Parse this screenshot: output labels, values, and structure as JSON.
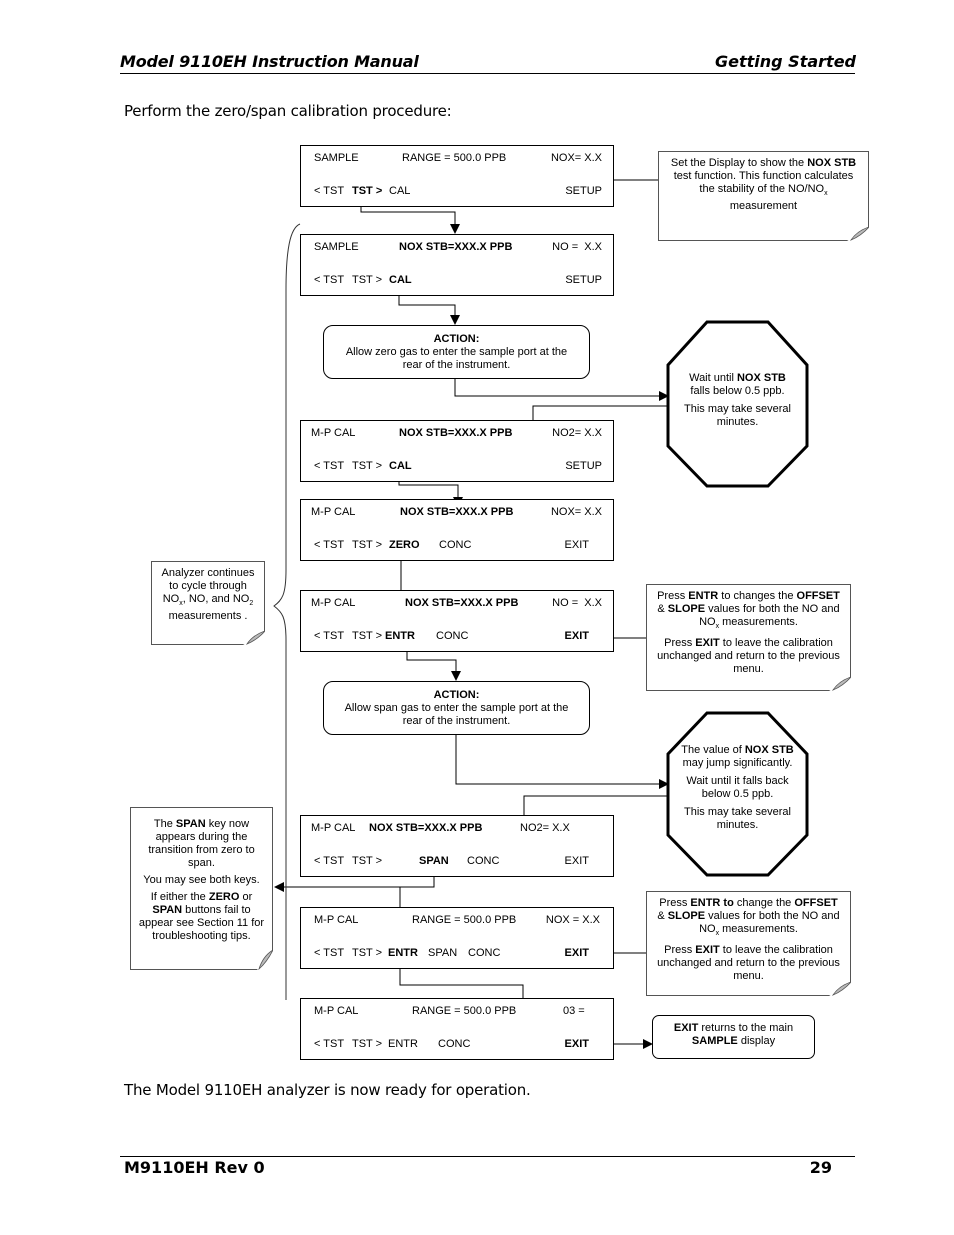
{
  "header": {
    "title": "Model 9110EH Instruction Manual",
    "section": "Getting Started"
  },
  "intro": "Perform the zero/span calibration procedure:",
  "outro": "The Model 9110EH analyzer is now ready for operation.",
  "footer": {
    "revision": "M9110EH Rev 0",
    "page": "29"
  },
  "screens": [
    {
      "mode": "SAMPLE",
      "message": "RANGE = 500.0 PPB",
      "reading": "NOX= X.X",
      "keys": [
        "< TST",
        "TST >",
        "CAL",
        "SETUP"
      ]
    },
    {
      "mode": "SAMPLE",
      "message": "NOX STB=XXX.X PPB",
      "reading": "NO =  X.X",
      "keys": [
        "< TST",
        "TST >",
        "CAL",
        "SETUP"
      ]
    },
    {
      "mode": "M-P CAL",
      "message": "NOX STB=XXX.X PPB",
      "reading": "NO2= X.X",
      "keys": [
        "< TST",
        "TST >",
        "CAL",
        "SETUP"
      ]
    },
    {
      "mode": "M-P CAL",
      "message": "NOX STB=XXX.X PPB",
      "reading": "NOX= X.X",
      "keys": [
        "< TST",
        "TST >",
        "ZERO",
        "CONC",
        "EXIT"
      ]
    },
    {
      "mode": "M-P CAL",
      "message": "NOX STB=XXX.X PPB",
      "reading": "NO =  X.X",
      "keys": [
        "< TST",
        "TST >",
        "ENTR",
        "CONC",
        "EXIT"
      ]
    },
    {
      "mode": "M-P CAL",
      "message": "NOX STB=XXX.X PPB",
      "reading": "NO2= X.X",
      "keys": [
        "< TST",
        "TST >",
        "SPAN",
        "CONC",
        "EXIT"
      ]
    },
    {
      "mode": "M-P CAL",
      "message": "RANGE = 500.0 PPB",
      "reading": "NOX = X.X",
      "keys": [
        "< TST",
        "TST >",
        "ENTR",
        "SPAN",
        "CONC",
        "EXIT"
      ]
    },
    {
      "mode": "M-P CAL",
      "message": "RANGE = 500.0 PPB",
      "reading": "03 =",
      "keys": [
        "< TST",
        "TST >",
        "ENTR",
        "CONC",
        "EXIT"
      ]
    }
  ],
  "actions": [
    {
      "title": "ACTION:",
      "text": "Allow zero gas to enter the sample port at the rear of the instrument."
    },
    {
      "title": "ACTION:",
      "text": "Allow span gas to enter the sample port at the rear of the instrument."
    }
  ],
  "notes": {
    "display": {
      "pre": "Set the Display to show the",
      "bold": "NOX STB",
      "post": "test function. This function calculates the stability of the NO/NO",
      "sub": "x",
      "end": "measurement"
    },
    "cycle": {
      "l1": "Analyzer continues to cycle through NO",
      "sub1": "x",
      "l2": ", NO, and NO",
      "sub2": "2",
      "l3": " measurements ."
    },
    "entr1": {
      "p1a": "Press ",
      "p1b": "ENTR",
      "p1c": " to changes the ",
      "p1d": "OFFSET",
      "p1e": " & ",
      "p1f": "SLOPE",
      "p1g": " values for both the NO and NO",
      "p1sub": "x",
      "p1h": " measurements.",
      "p2a": "Press ",
      "p2b": "EXIT",
      "p2c": " to leave the calibration unchanged and return to the previous menu."
    },
    "entr2": {
      "p1a": "Press ",
      "p1b": "ENTR to",
      "p1c": " change the ",
      "p1d": "OFFSET",
      "p1e": "  & ",
      "p1f": "SLOPE",
      "p1g": " values for both the NO and NO",
      "p1sub": "x",
      "p1h": " measurements.",
      "p2a": "Press ",
      "p2b": "EXIT",
      "p2c": " to leave the calibration unchanged and return to the previous menu."
    },
    "span": {
      "p1a": "The ",
      "p1b": "SPAN",
      "p1c": " key now appears during the transition from zero to span.",
      "p2": "You may see both keys.",
      "p3a": "If either the ",
      "p3b": "ZERO",
      "p3c": " or ",
      "p3d": "SPAN",
      "p3e": " buttons fail to appear see Section 11 for troubleshooting tips."
    },
    "exit": {
      "a": "EXIT",
      "b": " returns to the main ",
      "c": "SAMPLE",
      "d": " display"
    }
  },
  "stops": [
    {
      "a": "Wait until ",
      "b": "NOX STB",
      "c": " falls below 0.5 ppb.",
      "p2": "This may take several minutes."
    },
    {
      "p1a": "The value of ",
      "p1b": "NOX STB",
      "p1c": " may jump significantly.",
      "p2": "Wait until it falls back below  0.5 ppb.",
      "p3": "This may take several minutes."
    }
  ]
}
